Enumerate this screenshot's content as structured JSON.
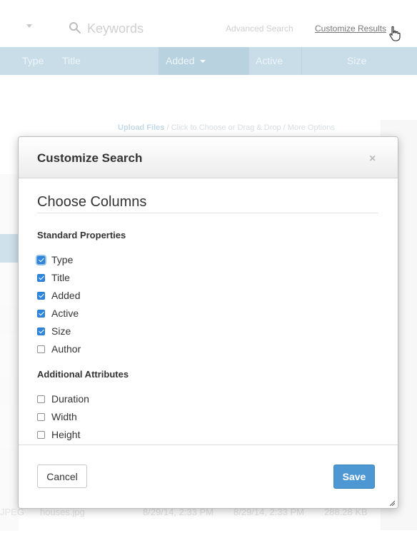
{
  "toolbar": {
    "search_placeholder": "Keywords",
    "advanced_search_label": "Advanced Search",
    "customize_results_label": "Customize Results"
  },
  "results_header": {
    "columns": [
      "Type",
      "Title",
      "Added",
      "Active",
      "Size"
    ],
    "sorted_column": "Added"
  },
  "upload_bar": {
    "upload_label": "Upload Files",
    "hint_text": " / Click to Choose or Drag & Drop / More Options"
  },
  "background_rows": {
    "last_row": {
      "type": "JPEG",
      "title": "houses.jpg",
      "added": "8/29/14, 2:33 PM",
      "active": "8/29/14, 2:33 PM",
      "size": "288.28 KB"
    }
  },
  "modal": {
    "title": "Customize Search",
    "section_title": "Choose Columns",
    "standard_group_title": "Standard Properties",
    "standard_options": [
      {
        "label": "Type",
        "checked": true
      },
      {
        "label": "Title",
        "checked": true
      },
      {
        "label": "Added",
        "checked": true
      },
      {
        "label": "Active",
        "checked": true
      },
      {
        "label": "Size",
        "checked": true
      },
      {
        "label": "Author",
        "checked": false
      }
    ],
    "additional_group_title": "Additional Attributes",
    "additional_options": [
      {
        "label": "Duration",
        "checked": false
      },
      {
        "label": "Width",
        "checked": false
      },
      {
        "label": "Height",
        "checked": false
      }
    ],
    "cancel_label": "Cancel",
    "save_label": "Save"
  },
  "colors": {
    "header_band": "#c8dde8",
    "primary_button": "#4d97d3",
    "checkbox_checked": "#2f86dc"
  }
}
